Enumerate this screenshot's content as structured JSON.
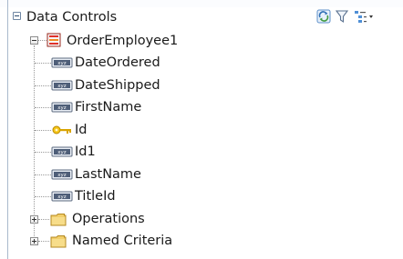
{
  "header": {
    "title": "Data Controls",
    "toolbar": {
      "refresh_icon": "refresh-icon",
      "filter_icon": "filter-icon",
      "view_menu_icon": "tree-view-menu-icon"
    }
  },
  "tree": {
    "root": {
      "label": "OrderEmployee1",
      "icon": "data-control-collection-icon",
      "expanded": true
    },
    "attributes": [
      {
        "label": "DateOrdered",
        "icon": "attribute-icon"
      },
      {
        "label": "DateShipped",
        "icon": "attribute-icon"
      },
      {
        "label": "FirstName",
        "icon": "attribute-icon"
      },
      {
        "label": "Id",
        "icon": "key-icon"
      },
      {
        "label": "Id1",
        "icon": "attribute-icon"
      },
      {
        "label": "LastName",
        "icon": "attribute-icon"
      },
      {
        "label": "TitleId",
        "icon": "attribute-icon"
      }
    ],
    "folders": [
      {
        "label": "Operations",
        "icon": "folder-icon",
        "expanded": false
      },
      {
        "label": "Named Criteria",
        "icon": "folder-icon",
        "expanded": false
      }
    ]
  },
  "colors": {
    "border": "#a9b9cc",
    "folder": "#f2cf6b",
    "collection_icon": "#e0312b",
    "key": "#d9a400"
  }
}
